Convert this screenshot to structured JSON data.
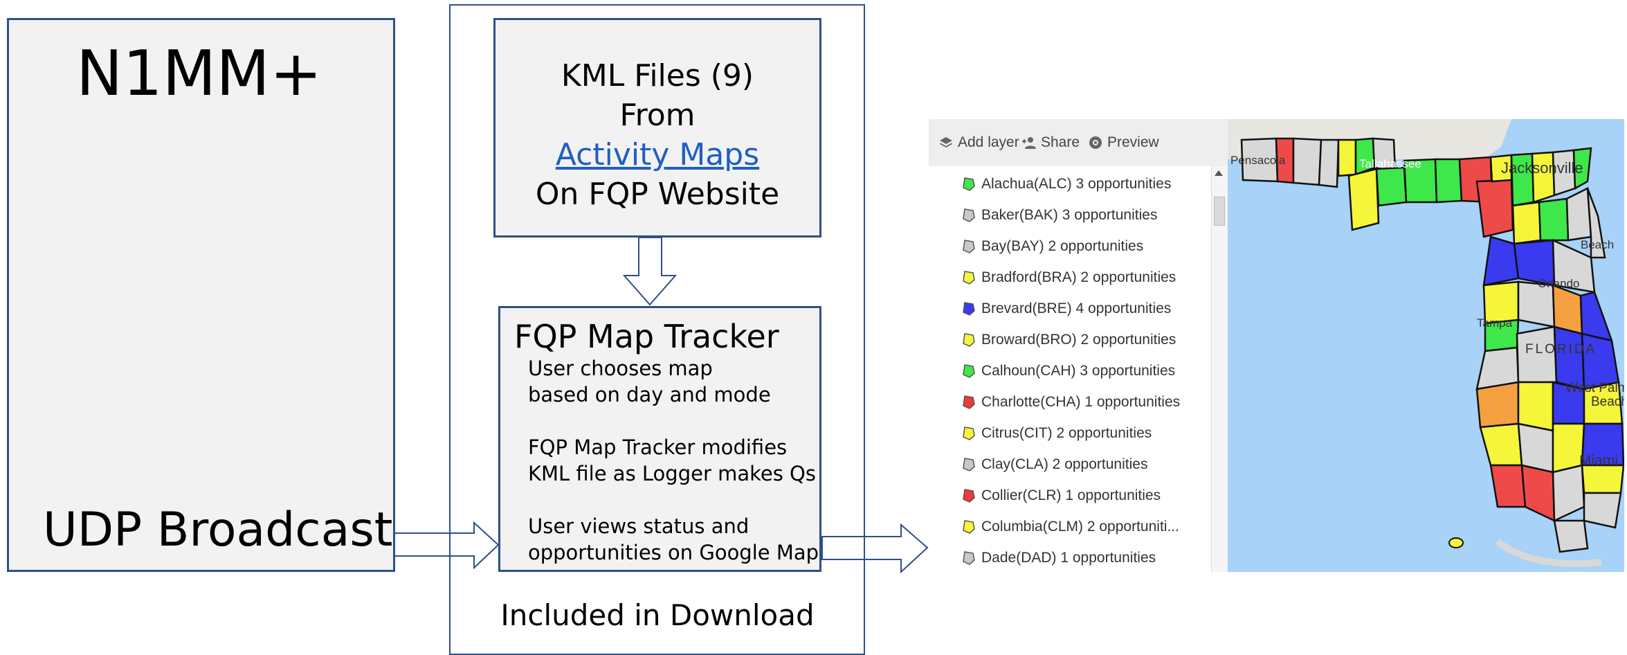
{
  "n1mm": {
    "title": "N1MM+",
    "udp_label": "UDP Broadcast"
  },
  "kml": {
    "line1": "KML Files (9)",
    "line2": "From",
    "link": "Activity Maps",
    "line4": "On FQP Website"
  },
  "tracker": {
    "title": "FQP Map Tracker",
    "lines": [
      "User chooses map",
      "based on day and mode",
      "FQP Map Tracker modifies",
      "KML file as Logger makes Qs",
      "User views status  and",
      "opportunities on Google Map"
    ]
  },
  "download_label": "Included in Download",
  "map": {
    "toolbar": {
      "add_layer": "Add layer",
      "share": "Share",
      "preview": "Preview"
    },
    "layers": [
      {
        "label": "Alachua(ALC) 3 opportunities",
        "color": "#3ee84a"
      },
      {
        "label": "Baker(BAK) 3 opportunities",
        "color": "#c8c8c8"
      },
      {
        "label": "Bay(BAY) 2 opportunities",
        "color": "#c8c8c8"
      },
      {
        "label": "Bradford(BRA) 2 opportunities",
        "color": "#f5f53a"
      },
      {
        "label": "Brevard(BRE) 4 opportunities",
        "color": "#3a3aee"
      },
      {
        "label": "Broward(BRO) 2 opportunities",
        "color": "#f5f53a"
      },
      {
        "label": "Calhoun(CAH) 3 opportunities",
        "color": "#3ee84a"
      },
      {
        "label": "Charlotte(CHA) 1 opportunities",
        "color": "#ee3a3a"
      },
      {
        "label": "Citrus(CIT) 2 opportunities",
        "color": "#f5f53a"
      },
      {
        "label": "Clay(CLA) 2 opportunities",
        "color": "#c8c8c8"
      },
      {
        "label": "Collier(CLR) 1 opportunities",
        "color": "#ee3a3a"
      },
      {
        "label": "Columbia(CLM) 2 opportuniti...",
        "color": "#f5f53a"
      },
      {
        "label": "Dade(DAD) 1 opportunities",
        "color": "#c8c8c8"
      }
    ],
    "cities": {
      "pensacola": "Pensacola",
      "tallahassee": "Tallahassee",
      "jacksonville": "Jacksonville",
      "daytona": "Beach",
      "orlando": "Orlando",
      "tampa": "Tampa",
      "florida": "FLORIDA",
      "west_palm": "West Palm",
      "west_palm2": "Beach",
      "miami": "Miami"
    }
  }
}
